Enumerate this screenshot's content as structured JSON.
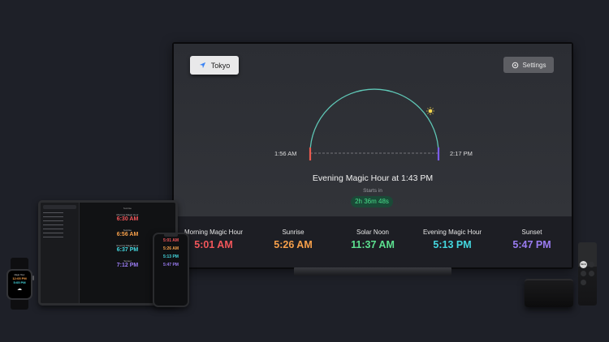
{
  "tv": {
    "location_label": "Tokyo",
    "settings_label": "Settings",
    "arc_start_time": "1:56 AM",
    "arc_end_time": "2:17 PM",
    "next_event_title": "Evening Magic Hour at 1:43 PM",
    "starts_in_label": "Starts in",
    "countdown": "2h 36m 48s",
    "colors": {
      "arc": "#5fc7b6",
      "sun": "#f4d64e",
      "start_marker": "#ea5a4f",
      "end_marker": "#7a5ce8",
      "countdown_text": "#49e08c"
    },
    "events": [
      {
        "label": "Morning Magic Hour",
        "time": "5:01 AM",
        "color": "#f2565a"
      },
      {
        "label": "Sunrise",
        "time": "5:26 AM",
        "color": "#f7a04a"
      },
      {
        "label": "Solar Noon",
        "time": "11:37 AM",
        "color": "#5ce08f"
      },
      {
        "label": "Evening Magic Hour",
        "time": "5:13 PM",
        "color": "#44d8e0"
      },
      {
        "label": "Sunset",
        "time": "5:47 PM",
        "color": "#9a7cf2"
      }
    ]
  },
  "ipad": {
    "header": "Sunrise",
    "events": [
      {
        "label": "Morning Magic Hour",
        "time": "6:30 AM",
        "color": "#f2565a"
      },
      {
        "label": "Sunrise",
        "time": "6:56 AM",
        "color": "#f7a04a"
      },
      {
        "label": "Evening Magic Hour",
        "time": "6:37 PM",
        "color": "#44d8e0"
      },
      {
        "label": "Sunset",
        "time": "7:12 PM",
        "color": "#9a7cf2"
      }
    ]
  },
  "iphone": {
    "events": [
      {
        "time": "5:01 AM",
        "color": "#f2565a"
      },
      {
        "time": "5:26 AM",
        "color": "#f7a04a"
      },
      {
        "time": "5:13 PM",
        "color": "#44d8e0"
      },
      {
        "time": "5:47 PM",
        "color": "#9a7cf2"
      }
    ]
  },
  "watch": {
    "label": "Magic Hour",
    "time_1": "12:05 PM",
    "time_2": "5:05 PM",
    "icon": "cloud-icon"
  },
  "icons": {
    "location": "location-arrow-icon",
    "settings": "gear-icon",
    "sun": "sun-icon"
  }
}
